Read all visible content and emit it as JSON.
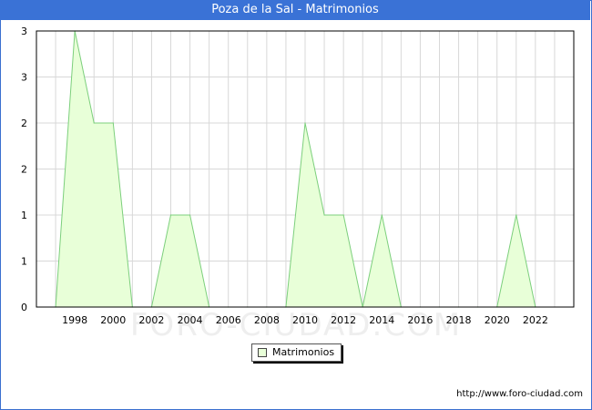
{
  "header": {
    "title": "Poza de la Sal - Matrimonios"
  },
  "watermark": "FORO-CIUDAD.COM",
  "legend": {
    "label": "Matrimonios",
    "placement": "bottom-center"
  },
  "footer": {
    "source": "http://www.foro-ciudad.com"
  },
  "colors": {
    "header": "#3a72d6",
    "area_fill": "#e8ffd8",
    "area_line": "#7ccf7c",
    "grid": "#d8d8d8"
  },
  "chart_data": {
    "type": "area",
    "title": "Poza de la Sal - Matrimonios",
    "xlabel": "",
    "ylabel": "",
    "x": [
      1997,
      1998,
      1999,
      2000,
      2001,
      2002,
      2003,
      2004,
      2005,
      2006,
      2007,
      2008,
      2009,
      2010,
      2011,
      2012,
      2013,
      2014,
      2015,
      2016,
      2017,
      2018,
      2019,
      2020,
      2021,
      2022
    ],
    "series": [
      {
        "name": "Matrimonios",
        "values": [
          0,
          3,
          2,
          2,
          0,
          0,
          1,
          1,
          0,
          0,
          0,
          0,
          0,
          2,
          1,
          1,
          0,
          1,
          0,
          0,
          0,
          0,
          0,
          0,
          1,
          0
        ]
      }
    ],
    "xticks": [
      "1998",
      "2000",
      "2002",
      "2004",
      "2006",
      "2008",
      "2010",
      "2012",
      "2014",
      "2016",
      "2018",
      "2020",
      "2022"
    ],
    "yticks": [
      "0",
      "1",
      "1",
      "2",
      "2",
      "3",
      "3"
    ],
    "xlim": [
      1996,
      2024
    ],
    "ylim": [
      0,
      3
    ],
    "grid": true,
    "legend_position": "bottom-center"
  }
}
